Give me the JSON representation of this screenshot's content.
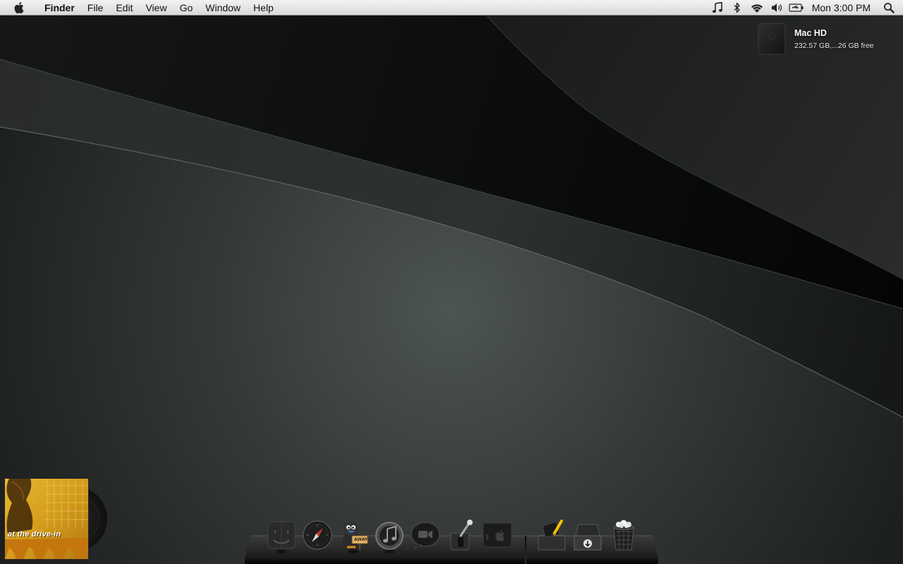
{
  "menubar": {
    "apple_icon": "apple-logo-icon",
    "app_name": "Finder",
    "menus": [
      "File",
      "Edit",
      "View",
      "Go",
      "Window",
      "Help"
    ],
    "status_icons": [
      "music-note-icon",
      "bluetooth-icon",
      "wifi-icon",
      "volume-icon",
      "battery-icon"
    ],
    "clock": "Mon 3:00 PM",
    "spotlight_icon": "spotlight-search-icon"
  },
  "desktop": {
    "drive": {
      "name": "Mac HD",
      "info": "232.57 GB,...26 GB free",
      "icon": "hard-drive-icon"
    },
    "album_widget": {
      "cover_text": "at the drive-in",
      "colors": {
        "cover": "#d9a21f",
        "disc": "#1a1a1a"
      }
    }
  },
  "dock": {
    "items": [
      {
        "id": "finder",
        "icon": "finder-icon",
        "running": true
      },
      {
        "id": "safari",
        "icon": "safari-compass-icon",
        "running": false
      },
      {
        "id": "adium",
        "icon": "adium-duck-icon",
        "badge_text": "AWAY",
        "running": true
      },
      {
        "id": "itunes",
        "icon": "itunes-icon",
        "running": true
      },
      {
        "id": "facetime",
        "icon": "facetime-camera-icon",
        "running": false
      },
      {
        "id": "system-preferences",
        "icon": "system-preferences-switch-icon",
        "running": false
      },
      {
        "id": "apple-store",
        "icon": "apple-box-icon",
        "running": false
      },
      {
        "id": "documents",
        "icon": "documents-stack-icon",
        "running": false
      },
      {
        "id": "downloads",
        "icon": "downloads-box-icon",
        "running": false
      },
      {
        "id": "trash",
        "icon": "trash-full-icon",
        "running": false
      }
    ]
  },
  "colors": {
    "wallpaper_dark": "#0c0d0d",
    "wallpaper_mid": "#2b2e2e",
    "wallpaper_light": "#4a5050",
    "menubar": "#e6e6e6"
  }
}
